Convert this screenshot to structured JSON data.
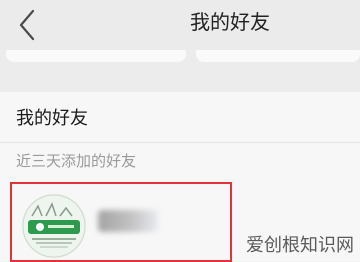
{
  "header": {
    "title": "我的好友",
    "back_icon": "chevron-left-icon"
  },
  "section": {
    "title": "我的好友",
    "recent_label": "近三天添加的好友"
  },
  "friends": [
    {
      "avatar_icon": "avatar-image"
    }
  ],
  "watermark": "爱创根知识网",
  "colors": {
    "highlight_border": "#e2333a",
    "header_bg": "#ebebeb",
    "section_bg": "#f7f7f7"
  }
}
